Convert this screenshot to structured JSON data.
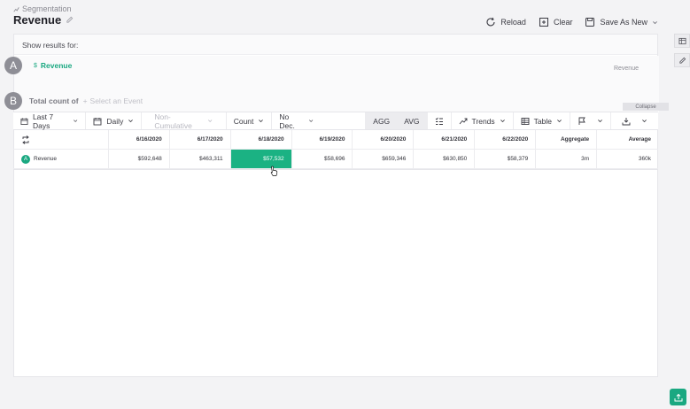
{
  "breadcrumb": "Segmentation",
  "title": "Revenue",
  "actions": {
    "reload": "Reload",
    "clear": "Clear",
    "save_as_new": "Save As New"
  },
  "results_header": "Show results for:",
  "query_a": {
    "badge": "A",
    "event": "Revenue",
    "tag": "Revenue"
  },
  "query_b": {
    "badge": "B",
    "label": "Total count of",
    "placeholder": "Select an Event"
  },
  "collapse_label": "Collapse",
  "toolbar": {
    "date_range": "Last 7 Days",
    "interval": "Daily",
    "cumulative": "Non-Cumulative",
    "metric": "Count",
    "decimals": "No Dec.",
    "agg": "AGG",
    "avg": "AVG",
    "trends": "Trends",
    "view": "Table"
  },
  "table": {
    "columns": [
      "6/16/2020",
      "6/17/2020",
      "6/18/2020",
      "6/19/2020",
      "6/20/2020",
      "6/21/2020",
      "6/22/2020",
      "Aggregate",
      "Average"
    ],
    "rows": [
      {
        "badge": "A",
        "label": "Revenue",
        "values": [
          "$592,648",
          "$463,311",
          "$57,532",
          "$58,696",
          "$659,346",
          "$630,850",
          "$58,379",
          "3m",
          "360k"
        ]
      }
    ]
  },
  "colors": {
    "accent": "#1bb283",
    "badge_grey": "#8e8e96"
  },
  "icons": [
    "segmentation-icon",
    "pencil-icon",
    "reload-icon",
    "clear-icon",
    "save-icon",
    "chevron-down-icon",
    "calendar-icon",
    "swap-icon",
    "list-icon",
    "trends-icon",
    "table-icon",
    "flag-icon",
    "download-icon",
    "cursor-icon"
  ]
}
